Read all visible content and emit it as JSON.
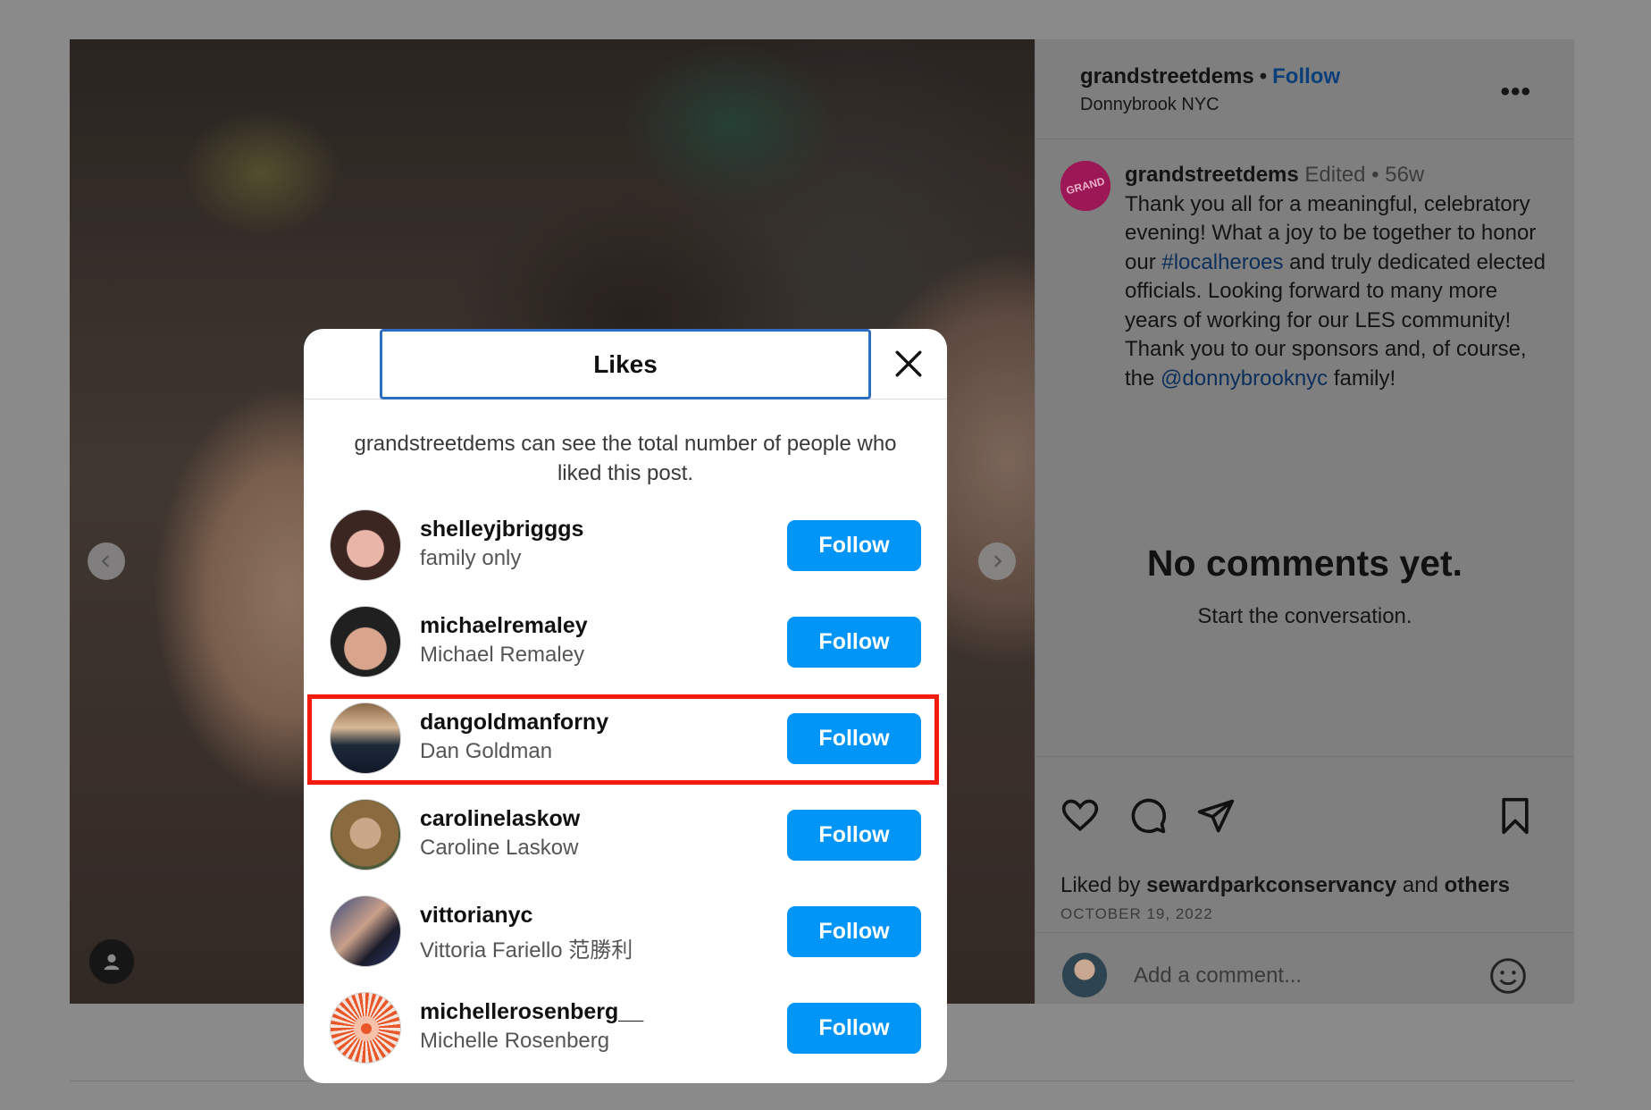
{
  "post": {
    "username": "grandstreetdems",
    "follow_label": "Follow",
    "dot": "•",
    "location": "Donnybrook NYC",
    "more": "•••",
    "caption": {
      "username": "grandstreetdems",
      "edited": "Edited",
      "dot": "•",
      "age": "56w",
      "text_1": "Thank you all for a meaningful, celebratory evening! What a joy to be together to honor our ",
      "hashtag": "#localheroes",
      "text_2": " and truly dedicated elected officials. Looking forward to many more years of working for our LES community!",
      "text_3": "Thank you to our sponsors and, of course, the ",
      "mention": "@donnybrooknyc",
      "text_4": " family!"
    },
    "no_comments_title": "No comments yet.",
    "no_comments_sub": "Start the conversation.",
    "liked_by_prefix": "Liked by ",
    "liked_by_user": "sewardparkconservancy",
    "liked_by_mid": " and ",
    "liked_by_others": "others",
    "date": "OCTOBER 19, 2022",
    "comment_placeholder": "Add a comment..."
  },
  "modal": {
    "title": "Likes",
    "notice": "grandstreetdems can see the total number of people who liked this post.",
    "likes": [
      {
        "username": "shelleyjbrigggs",
        "name": "family only",
        "button": "Follow"
      },
      {
        "username": "michaelremaley",
        "name": "Michael Remaley",
        "button": "Follow"
      },
      {
        "username": "dangoldmanforny",
        "name": "Dan Goldman",
        "button": "Follow"
      },
      {
        "username": "carolinelaskow",
        "name": "Caroline Laskow",
        "button": "Follow"
      },
      {
        "username": "vittorianyc",
        "name": "Vittoria Fariello 范勝利",
        "button": "Follow"
      },
      {
        "username": "michellerosenberg__",
        "name": "Michelle Rosenberg",
        "button": "Follow"
      }
    ]
  },
  "colors": {
    "follow_button": "#0095f6",
    "highlight": "#f41a0c",
    "title_focus": "#2f6dc4",
    "overlay": "#8a8a8a"
  }
}
